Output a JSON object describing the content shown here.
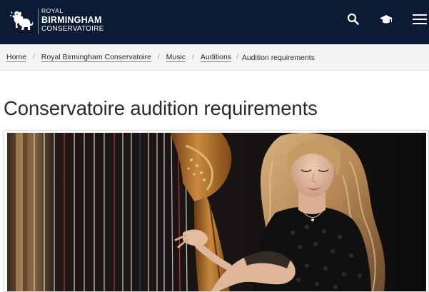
{
  "header": {
    "logo": {
      "line1": "ROYAL",
      "line2": "BIRMINGHAM",
      "line3": "CONSERVATOIRE"
    },
    "tools": [
      {
        "icon": "search-icon"
      },
      {
        "icon": "graduation-cap-icon"
      },
      {
        "icon": "menu-icon"
      }
    ],
    "colors": {
      "background": "#0c1a36",
      "foreground": "#ffffff"
    }
  },
  "breadcrumb": {
    "items": [
      {
        "label": "Home"
      },
      {
        "label": "Royal Birmingham Conservatoire"
      },
      {
        "label": "Music"
      },
      {
        "label": "Auditions"
      }
    ],
    "current": "Audition requirements",
    "separator": "/"
  },
  "main": {
    "title": "Conservatoire audition requirements",
    "hero": {
      "icon": "harpist-photo"
    }
  }
}
